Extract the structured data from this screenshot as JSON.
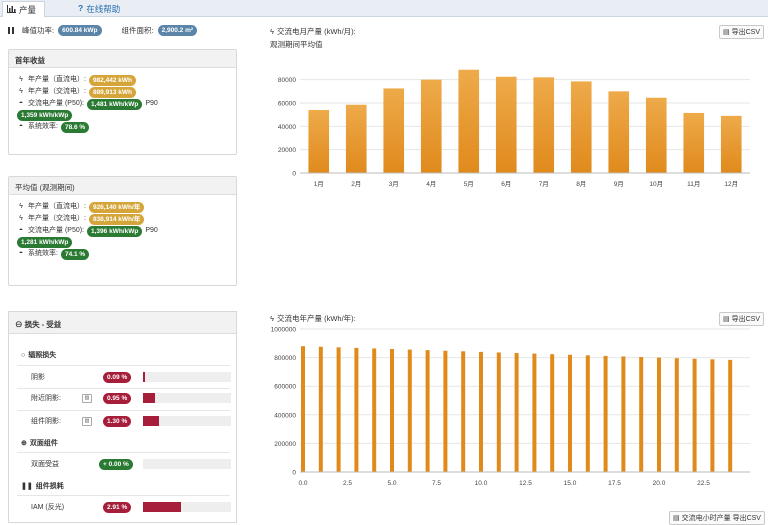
{
  "tab": {
    "label": "产量"
  },
  "help": {
    "label": "在线帮助"
  },
  "summary": {
    "peak_power_label": "峰值功率:",
    "peak_power_value": "600.84 kWp",
    "module_area_label": "组件面积:",
    "module_area_value": "2,900.2 m²"
  },
  "first_year": {
    "title": "首年收益",
    "dc_label": "年产量（直流电）:",
    "dc_value": "982,442 kWh",
    "ac_label": "年产量（交流电）:",
    "ac_value": "889,913 kWh",
    "spec_label": "交流电产量 (P50):",
    "spec_value": "1,481 kWh/kWp",
    "p90_label": "P90",
    "p90_value": "1,359 kWh/kWp",
    "pr_label": "系统效率:",
    "pr_value": "78.6 %"
  },
  "average": {
    "title": "平均值 (观测期间)",
    "dc_label": "年产量（直流电）:",
    "dc_value": "926,140 kWh/年",
    "ac_label": "年产量（交流电）:",
    "ac_value": "838,914 kWh/年",
    "spec_label": "交流电产量 (P50):",
    "spec_value": "1,396 kWh/kWp",
    "p90_label": "P90",
    "p90_value": "1,281 kWh/kWp",
    "pr_label": "系统效率:",
    "pr_value": "74.1 %"
  },
  "losses": {
    "title": "损失 - 受益",
    "group1": "辐照损失",
    "items1": [
      {
        "label": "阴影",
        "value": "0.09 %",
        "fraction": 0.009
      },
      {
        "label": "附近阴影:",
        "value": "0.95 %",
        "fraction": 0.095
      },
      {
        "label": "组件阴影:",
        "value": "1.30 %",
        "fraction": 0.13
      }
    ],
    "group2": "双面组件",
    "items2": [
      {
        "label": "双面受益",
        "value": "+ 0.00 %",
        "fraction": 0.0
      }
    ],
    "group3": "组件损耗",
    "items3": [
      {
        "label": "IAM (反光)",
        "value": "2.91 %",
        "fraction": 0.291
      }
    ]
  },
  "csv_label": "导出CSV",
  "hourly_csv_label": "交流电小时产量 导出CSV",
  "colors": {
    "bar": "#e08a1c",
    "bar_light": "#eeaa4a",
    "green": "#2b7a34",
    "red": "#a61e3a",
    "gold": "#d5a53a",
    "blue": "#5a85a8"
  },
  "chart_data": [
    {
      "type": "bar",
      "title": "交流电月产量 (kWh/月):",
      "subtitle": "观测期间平均值",
      "categories": [
        "1月",
        "2月",
        "3月",
        "4月",
        "5月",
        "6月",
        "7月",
        "8月",
        "9月",
        "10月",
        "11月",
        "12月"
      ],
      "values": [
        54000,
        58500,
        72500,
        80000,
        88500,
        82500,
        82000,
        78500,
        70000,
        64500,
        51500,
        49000
      ],
      "ylim": [
        0,
        90000
      ],
      "yticks": [
        "0",
        "20000",
        "40000",
        "60000",
        "80000"
      ],
      "grid": true
    },
    {
      "type": "bar",
      "title": "交流电年产量 (kWh/年):",
      "x": [
        0,
        1,
        2,
        3,
        4,
        5,
        6,
        7,
        8,
        9,
        10,
        11,
        12,
        13,
        14,
        15,
        16,
        17,
        18,
        19,
        20,
        21,
        22,
        23,
        24
      ],
      "values": [
        880000,
        876000,
        872000,
        868000,
        864000,
        860000,
        856000,
        852000,
        848000,
        844000,
        840000,
        836000,
        832000,
        828000,
        824000,
        820000,
        816000,
        812000,
        808000,
        804000,
        800000,
        796000,
        792000,
        788000,
        784000
      ],
      "xlim": [
        0,
        25
      ],
      "xticks": [
        "0.0",
        "2.5",
        "5.0",
        "7.5",
        "10.0",
        "12.5",
        "15.0",
        "17.5",
        "20.0",
        "22.5"
      ],
      "ylim": [
        0,
        1000000
      ],
      "yticks": [
        "0",
        "200000",
        "400000",
        "600000",
        "800000",
        "1000000"
      ],
      "grid": true
    }
  ]
}
